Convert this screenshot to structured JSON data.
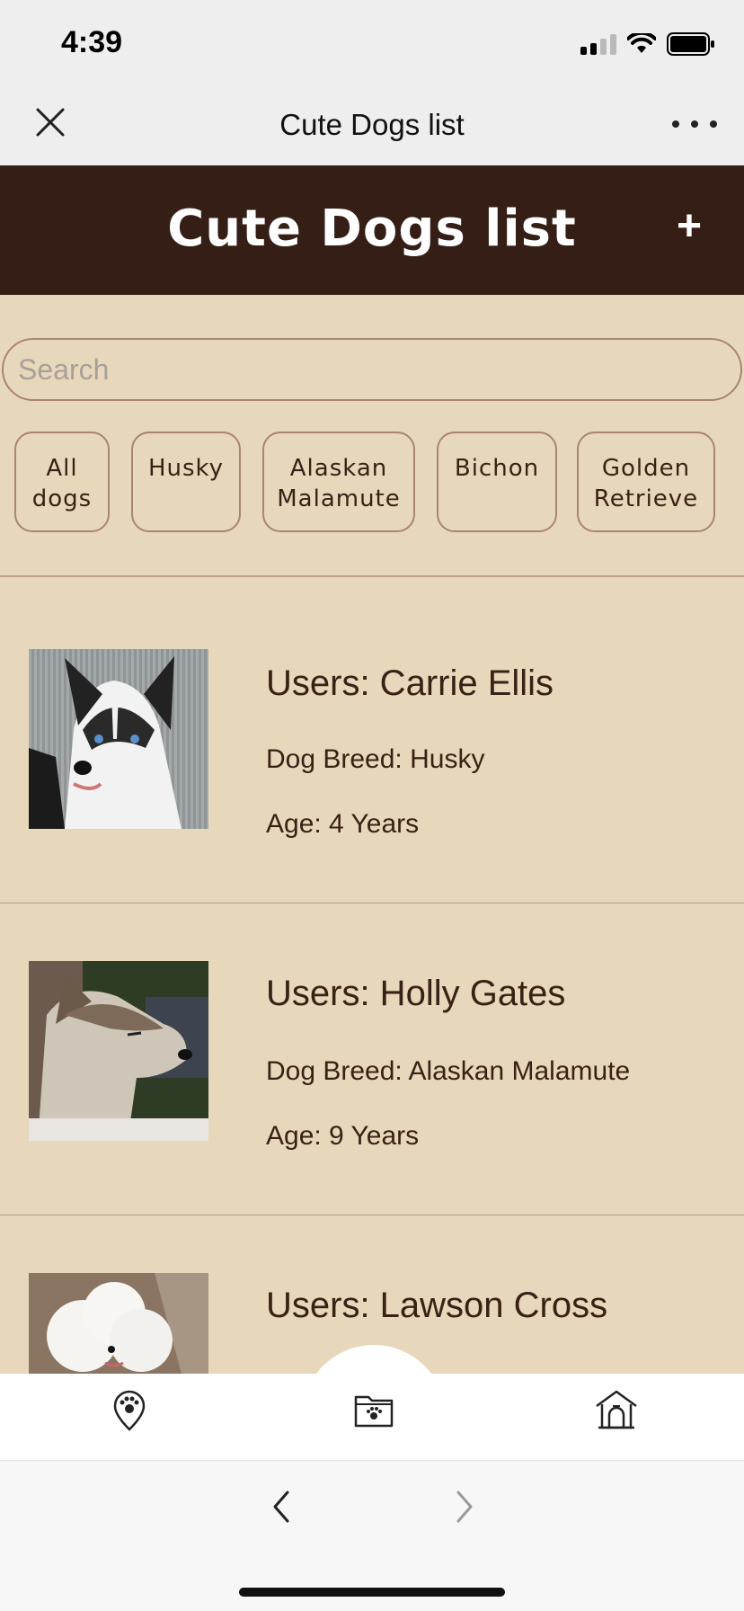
{
  "status_bar": {
    "time": "4:39"
  },
  "nav_bar": {
    "title": "Cute Dogs list"
  },
  "header": {
    "title": "Cute Dogs list",
    "add_label": "+"
  },
  "search": {
    "placeholder": "Search",
    "value": ""
  },
  "filters": [
    {
      "line1": "All",
      "line2": "dogs"
    },
    {
      "line1": "Husky",
      "line2": ""
    },
    {
      "line1": "Alaskan",
      "line2": "Malamute"
    },
    {
      "line1": "Bichon",
      "line2": ""
    },
    {
      "line1": "Golden",
      "line2": "Retrieve"
    }
  ],
  "dogs": [
    {
      "user": "Users: Carrie Ellis",
      "breed": "Dog Breed: Husky",
      "age": "Age: 4 Years"
    },
    {
      "user": "Users: Holly Gates",
      "breed": "Dog Breed: Alaskan Malamute",
      "age": "Age: 9 Years"
    },
    {
      "user": "Users: Lawson Cross",
      "breed": "",
      "age": ""
    }
  ],
  "tab_bar": {
    "icons": [
      "dog-location-icon",
      "dog-folder-icon",
      "dog-house-icon"
    ],
    "active": 1
  },
  "colors": {
    "header_bg": "#351e15",
    "page_bg": "#e8d8bb",
    "border": "#a98470",
    "text": "#3a2116"
  }
}
